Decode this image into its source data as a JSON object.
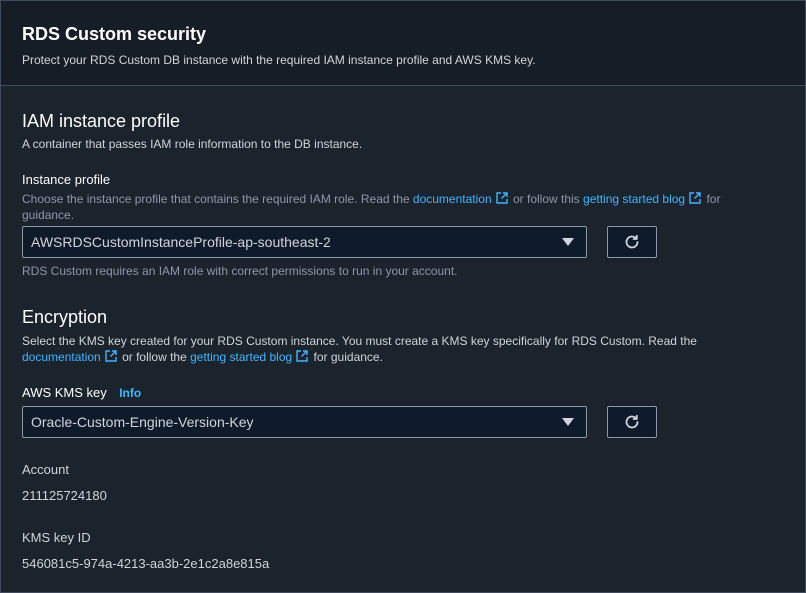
{
  "header": {
    "title": "RDS Custom security",
    "description": "Protect your RDS Custom DB instance with the required IAM instance profile and AWS KMS key."
  },
  "iam": {
    "title": "IAM instance profile",
    "description": "A container that passes IAM role information to the DB instance.",
    "field_label": "Instance profile",
    "hint_prefix": "Choose the instance profile that contains the required IAM role. Read the",
    "link_documentation": "documentation",
    "hint_middle": "or follow this",
    "link_blog": "getting started blog",
    "hint_suffix": "for",
    "hint_end": "guidance.",
    "selected_value": "AWSRDSCustomInstanceProfile-ap-southeast-2",
    "constraint": "RDS Custom requires an IAM role with correct permissions to run in your account."
  },
  "encryption": {
    "title": "Encryption",
    "desc_line1": "Select the KMS key created for your RDS Custom instance. You must create a KMS key specifically for RDS Custom. Read the",
    "link_documentation": "documentation",
    "desc_middle": "or follow the",
    "link_blog": "getting started blog",
    "desc_suffix": "for guidance.",
    "field_label": "AWS KMS key",
    "info_label": "Info",
    "selected_value": "Oracle-Custom-Engine-Version-Key"
  },
  "details": {
    "account_label": "Account",
    "account_value": "211125724180",
    "kms_id_label": "KMS key ID",
    "kms_id_value": "546081c5-974a-4213-aa3b-2e1c2a8e815a"
  },
  "colors": {
    "link": "#42b4ff",
    "panel_bg": "#1b232d",
    "border": "#414d5c"
  },
  "icons": {
    "external_link": "external-link-icon",
    "refresh": "refresh-icon",
    "caret": "caret-down-icon"
  }
}
